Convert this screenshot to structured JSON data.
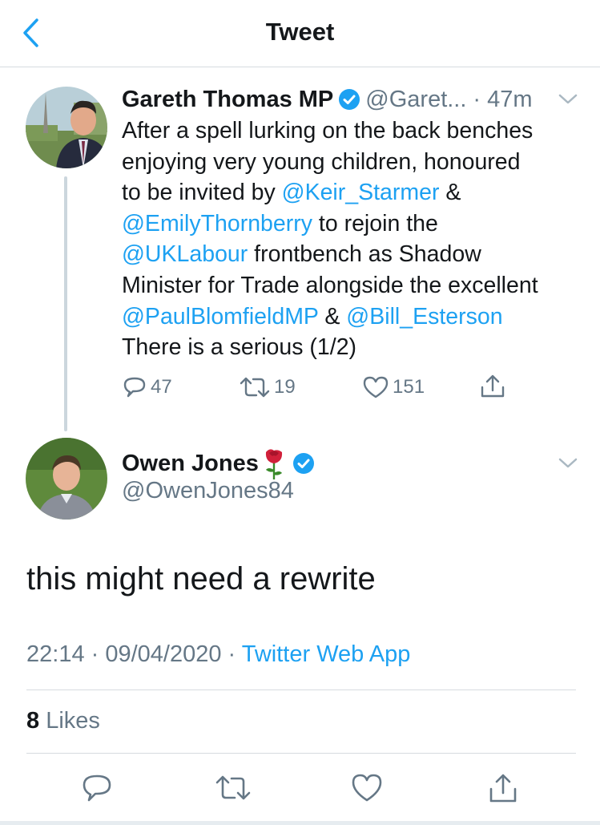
{
  "header": {
    "title": "Tweet",
    "back_icon": "chevron-left-icon"
  },
  "colors": {
    "accent": "#1da1f2",
    "secondary_text": "#657786",
    "primary_text": "#14171a",
    "like_color": "#657786"
  },
  "parent_tweet": {
    "name": "Gareth Thomas MP",
    "handle": "@Garet...",
    "time": "· 47m",
    "text_lines": [
      [
        {
          "t": "After a spell lurking on the back benches",
          "m": false
        }
      ],
      [
        {
          "t": "enjoying very young children, honoured",
          "m": false
        }
      ],
      [
        {
          "t": "to be invited by ",
          "m": false
        },
        {
          "t": "@Keir_Starmer",
          "m": true
        },
        {
          "t": " &",
          "m": false
        }
      ],
      [
        {
          "t": "@EmilyThornberry",
          "m": true
        },
        {
          "t": " to rejoin the",
          "m": false
        }
      ],
      [
        {
          "t": "@UKLabour",
          "m": true
        },
        {
          "t": " frontbench as Shadow",
          "m": false
        }
      ],
      [
        {
          "t": "Minister for Trade alongside the excellent",
          "m": false
        }
      ],
      [
        {
          "t": "@PaulBlomfieldMP",
          "m": true
        },
        {
          "t": " & ",
          "m": false
        },
        {
          "t": "@Bill_Esterson",
          "m": true
        }
      ],
      [
        {
          "t": "There is a serious (1/2)",
          "m": false
        }
      ]
    ],
    "replies": "47",
    "retweets": "19",
    "likes": "151"
  },
  "tweet": {
    "name": "Owen Jones",
    "handle": "@OwenJones84",
    "text": "this might need a rewrite",
    "time": "22:14 · 09/04/2020 · ",
    "app": "Twitter Web App",
    "likes_count": "8",
    "likes_label": " Likes"
  }
}
